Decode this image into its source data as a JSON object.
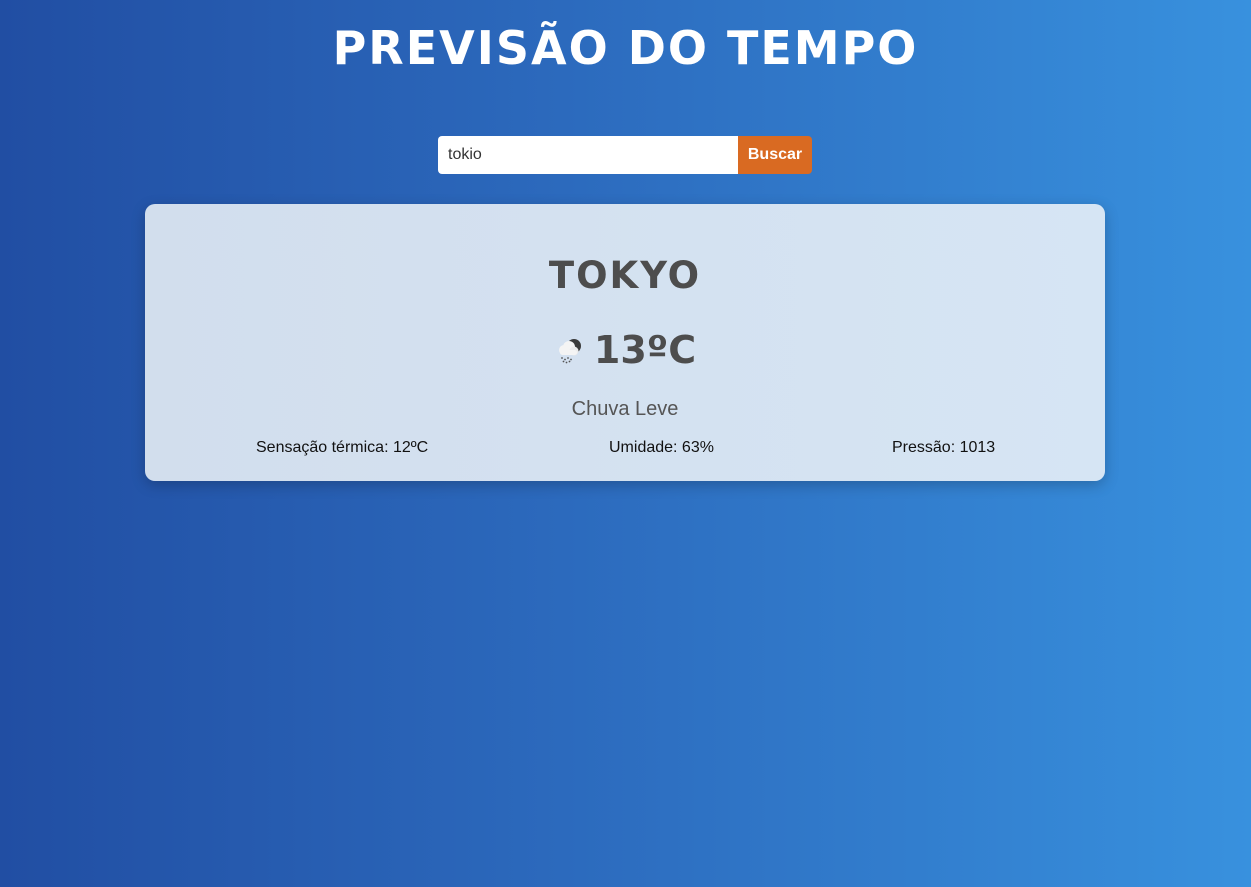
{
  "header": {
    "title": "PREVISÃO DO TEMPO"
  },
  "search": {
    "value": "tokio",
    "button_label": "Buscar"
  },
  "weather": {
    "city": "TOKYO",
    "icon": "rain-cloud-icon",
    "temperature": "13ºC",
    "description": "Chuva Leve",
    "feels_like": "Sensação térmica: 12ºC",
    "humidity": "Umidade: 63%",
    "pressure": "Pressão: 1013"
  },
  "colors": {
    "background_start": "#214ea3",
    "background_end": "#3891de",
    "button": "#d96a22",
    "card": "#d4e2f1",
    "text_dark": "#4d4d4d"
  }
}
